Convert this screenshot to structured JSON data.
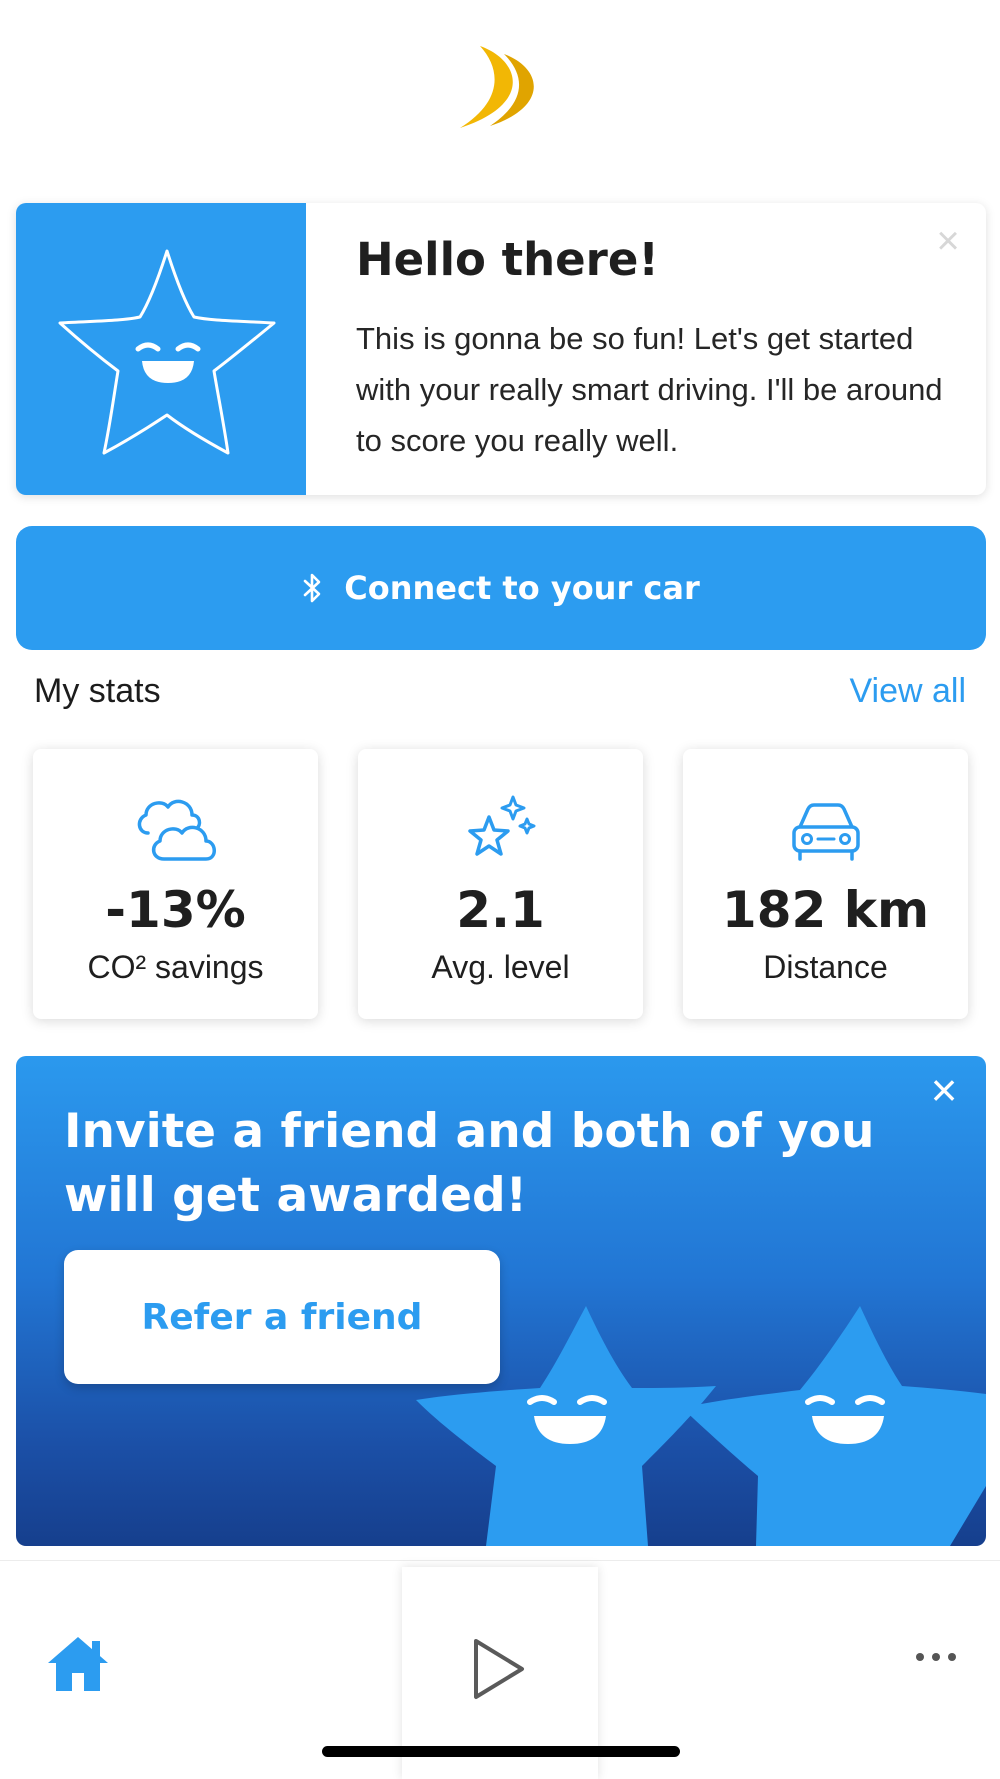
{
  "app": {
    "logo": "crescent-logo"
  },
  "welcome": {
    "title": "Hello there!",
    "body": "This is gonna be so fun! Let's get started with your really smart driving. I'll be around to score you really well.",
    "close_icon": "×"
  },
  "connect": {
    "label": "Connect to your car",
    "icon": "bluetooth-icon"
  },
  "stats": {
    "title": "My stats",
    "view_all": "View all",
    "items": [
      {
        "icon": "cloud-icon",
        "value": "-13%",
        "label": "CO² savings"
      },
      {
        "icon": "stars-icon",
        "value": "2.1",
        "label": "Avg. level"
      },
      {
        "icon": "car-icon",
        "value": "182 km",
        "label": "Distance"
      }
    ]
  },
  "promo": {
    "title": "Invite a friend and both of you will get awarded!",
    "button": "Refer a friend",
    "close_icon": "×"
  },
  "nav": {
    "home": "home-icon",
    "play": "play-icon",
    "more": "more-icon"
  },
  "colors": {
    "accent": "#2c9cf0",
    "promo_dark": "#163f8d",
    "logo": "#f2b705"
  }
}
